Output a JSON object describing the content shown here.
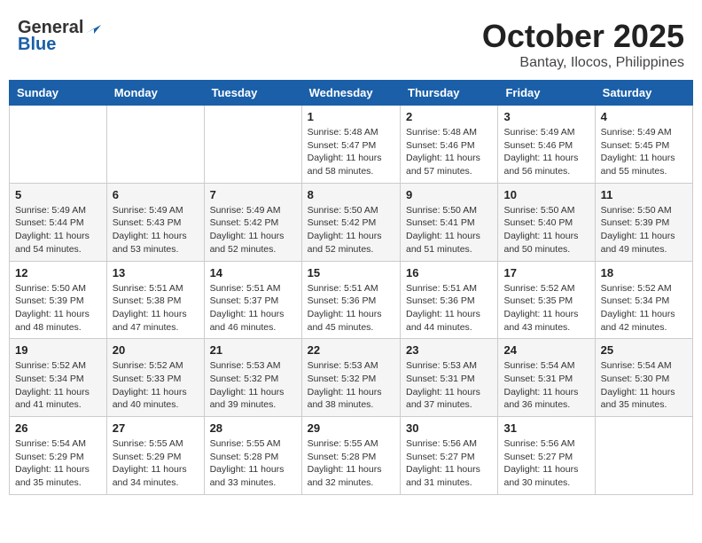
{
  "header": {
    "logo_general": "General",
    "logo_blue": "Blue",
    "month": "October 2025",
    "location": "Bantay, Ilocos, Philippines"
  },
  "weekdays": [
    "Sunday",
    "Monday",
    "Tuesday",
    "Wednesday",
    "Thursday",
    "Friday",
    "Saturday"
  ],
  "weeks": [
    [
      {
        "day": "",
        "info": ""
      },
      {
        "day": "",
        "info": ""
      },
      {
        "day": "",
        "info": ""
      },
      {
        "day": "1",
        "info": "Sunrise: 5:48 AM\nSunset: 5:47 PM\nDaylight: 11 hours\nand 58 minutes."
      },
      {
        "day": "2",
        "info": "Sunrise: 5:48 AM\nSunset: 5:46 PM\nDaylight: 11 hours\nand 57 minutes."
      },
      {
        "day": "3",
        "info": "Sunrise: 5:49 AM\nSunset: 5:46 PM\nDaylight: 11 hours\nand 56 minutes."
      },
      {
        "day": "4",
        "info": "Sunrise: 5:49 AM\nSunset: 5:45 PM\nDaylight: 11 hours\nand 55 minutes."
      }
    ],
    [
      {
        "day": "5",
        "info": "Sunrise: 5:49 AM\nSunset: 5:44 PM\nDaylight: 11 hours\nand 54 minutes."
      },
      {
        "day": "6",
        "info": "Sunrise: 5:49 AM\nSunset: 5:43 PM\nDaylight: 11 hours\nand 53 minutes."
      },
      {
        "day": "7",
        "info": "Sunrise: 5:49 AM\nSunset: 5:42 PM\nDaylight: 11 hours\nand 52 minutes."
      },
      {
        "day": "8",
        "info": "Sunrise: 5:50 AM\nSunset: 5:42 PM\nDaylight: 11 hours\nand 52 minutes."
      },
      {
        "day": "9",
        "info": "Sunrise: 5:50 AM\nSunset: 5:41 PM\nDaylight: 11 hours\nand 51 minutes."
      },
      {
        "day": "10",
        "info": "Sunrise: 5:50 AM\nSunset: 5:40 PM\nDaylight: 11 hours\nand 50 minutes."
      },
      {
        "day": "11",
        "info": "Sunrise: 5:50 AM\nSunset: 5:39 PM\nDaylight: 11 hours\nand 49 minutes."
      }
    ],
    [
      {
        "day": "12",
        "info": "Sunrise: 5:50 AM\nSunset: 5:39 PM\nDaylight: 11 hours\nand 48 minutes."
      },
      {
        "day": "13",
        "info": "Sunrise: 5:51 AM\nSunset: 5:38 PM\nDaylight: 11 hours\nand 47 minutes."
      },
      {
        "day": "14",
        "info": "Sunrise: 5:51 AM\nSunset: 5:37 PM\nDaylight: 11 hours\nand 46 minutes."
      },
      {
        "day": "15",
        "info": "Sunrise: 5:51 AM\nSunset: 5:36 PM\nDaylight: 11 hours\nand 45 minutes."
      },
      {
        "day": "16",
        "info": "Sunrise: 5:51 AM\nSunset: 5:36 PM\nDaylight: 11 hours\nand 44 minutes."
      },
      {
        "day": "17",
        "info": "Sunrise: 5:52 AM\nSunset: 5:35 PM\nDaylight: 11 hours\nand 43 minutes."
      },
      {
        "day": "18",
        "info": "Sunrise: 5:52 AM\nSunset: 5:34 PM\nDaylight: 11 hours\nand 42 minutes."
      }
    ],
    [
      {
        "day": "19",
        "info": "Sunrise: 5:52 AM\nSunset: 5:34 PM\nDaylight: 11 hours\nand 41 minutes."
      },
      {
        "day": "20",
        "info": "Sunrise: 5:52 AM\nSunset: 5:33 PM\nDaylight: 11 hours\nand 40 minutes."
      },
      {
        "day": "21",
        "info": "Sunrise: 5:53 AM\nSunset: 5:32 PM\nDaylight: 11 hours\nand 39 minutes."
      },
      {
        "day": "22",
        "info": "Sunrise: 5:53 AM\nSunset: 5:32 PM\nDaylight: 11 hours\nand 38 minutes."
      },
      {
        "day": "23",
        "info": "Sunrise: 5:53 AM\nSunset: 5:31 PM\nDaylight: 11 hours\nand 37 minutes."
      },
      {
        "day": "24",
        "info": "Sunrise: 5:54 AM\nSunset: 5:31 PM\nDaylight: 11 hours\nand 36 minutes."
      },
      {
        "day": "25",
        "info": "Sunrise: 5:54 AM\nSunset: 5:30 PM\nDaylight: 11 hours\nand 35 minutes."
      }
    ],
    [
      {
        "day": "26",
        "info": "Sunrise: 5:54 AM\nSunset: 5:29 PM\nDaylight: 11 hours\nand 35 minutes."
      },
      {
        "day": "27",
        "info": "Sunrise: 5:55 AM\nSunset: 5:29 PM\nDaylight: 11 hours\nand 34 minutes."
      },
      {
        "day": "28",
        "info": "Sunrise: 5:55 AM\nSunset: 5:28 PM\nDaylight: 11 hours\nand 33 minutes."
      },
      {
        "day": "29",
        "info": "Sunrise: 5:55 AM\nSunset: 5:28 PM\nDaylight: 11 hours\nand 32 minutes."
      },
      {
        "day": "30",
        "info": "Sunrise: 5:56 AM\nSunset: 5:27 PM\nDaylight: 11 hours\nand 31 minutes."
      },
      {
        "day": "31",
        "info": "Sunrise: 5:56 AM\nSunset: 5:27 PM\nDaylight: 11 hours\nand 30 minutes."
      },
      {
        "day": "",
        "info": ""
      }
    ]
  ]
}
